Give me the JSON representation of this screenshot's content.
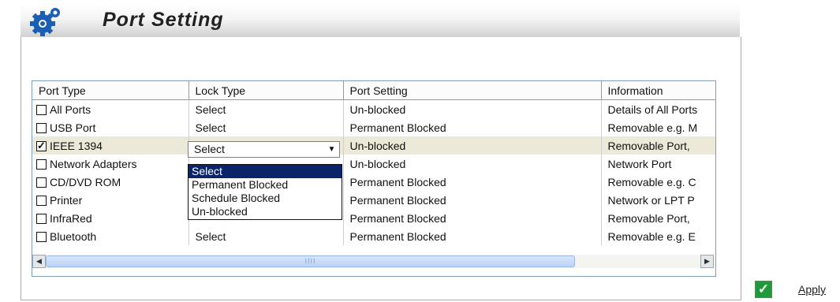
{
  "header": {
    "title": "Port Setting",
    "icon": "gears-icon"
  },
  "grid": {
    "columns": [
      "Port Type",
      "Lock Type",
      "Port Setting",
      "Information"
    ],
    "rows": [
      {
        "checked": false,
        "port_type": "All Ports",
        "lock_type": "Select",
        "port_setting": "Un-blocked",
        "information": "Details of All Ports"
      },
      {
        "checked": false,
        "port_type": "USB Port",
        "lock_type": "Select",
        "port_setting": "Permanent Blocked",
        "information": "Removable e.g. M"
      },
      {
        "checked": true,
        "port_type": "IEEE 1394",
        "lock_type": "Select",
        "port_setting": "Un-blocked",
        "information": "Removable Port,"
      },
      {
        "checked": false,
        "port_type": "Network Adapters",
        "lock_type": "",
        "port_setting": "Un-blocked",
        "information": "Network Port"
      },
      {
        "checked": false,
        "port_type": "CD/DVD ROM",
        "lock_type": "",
        "port_setting": "Permanent Blocked",
        "information": "Removable e.g. C"
      },
      {
        "checked": false,
        "port_type": "Printer",
        "lock_type": "",
        "port_setting": "Permanent Blocked",
        "information": "Network or LPT P"
      },
      {
        "checked": false,
        "port_type": "InfraRed",
        "lock_type": "",
        "port_setting": "Permanent Blocked",
        "information": "Removable Port,"
      },
      {
        "checked": false,
        "port_type": "Bluetooth",
        "lock_type": "Select",
        "port_setting": "Permanent Blocked",
        "information": "Removable e.g. E"
      }
    ],
    "combo_value": "Select",
    "dropdown_options": [
      "Select",
      "Permanent Blocked",
      "Schedule Blocked",
      "Un-blocked"
    ],
    "dropdown_highlight": "Select",
    "scroll_grip": "IIII"
  },
  "apply_label": "Apply",
  "colors": {
    "selection": "#0a246a",
    "selected_row": "#ece9d8",
    "apply_icon": "#1f9a3a"
  }
}
